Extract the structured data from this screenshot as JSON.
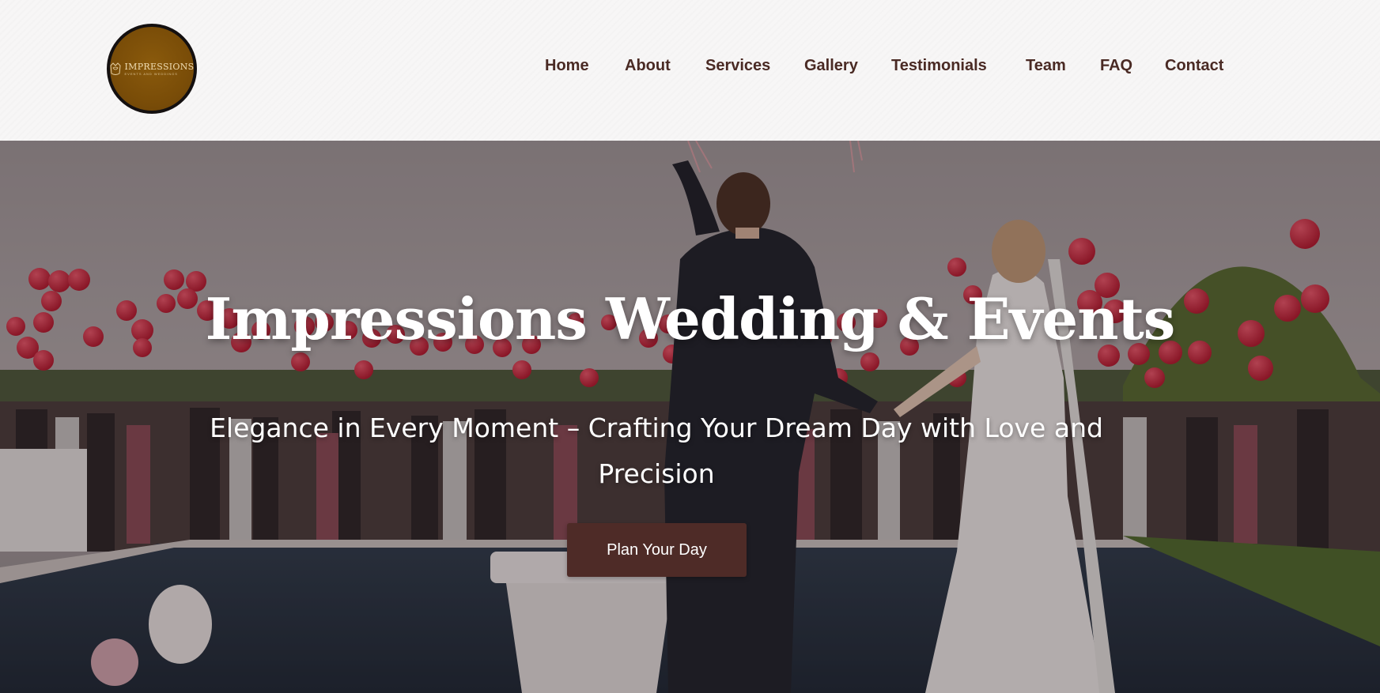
{
  "header": {
    "logo": {
      "name": "IMPRESSIONS",
      "tagline": "EVENTS AND WEDDINGS"
    },
    "nav": [
      {
        "label": "Home"
      },
      {
        "label": "About"
      },
      {
        "label": "Services"
      },
      {
        "label": "Gallery"
      },
      {
        "label": "Testimonials"
      },
      {
        "label": "Team"
      },
      {
        "label": "FAQ"
      },
      {
        "label": "Contact"
      }
    ]
  },
  "hero": {
    "title": "Impressions Wedding & Events",
    "subtitle": "Elegance in Every Moment – Crafting Your Dream Day with Love and Precision",
    "cta_label": "Plan Your Day",
    "image_description": "Bride and groom raising arms by a pool, guests releasing red balloons"
  },
  "colors": {
    "nav_text": "#4a2a24",
    "cta_background": "#4e2b27",
    "logo_gold": "#7a4d08",
    "header_background": "#f7f6f6"
  }
}
